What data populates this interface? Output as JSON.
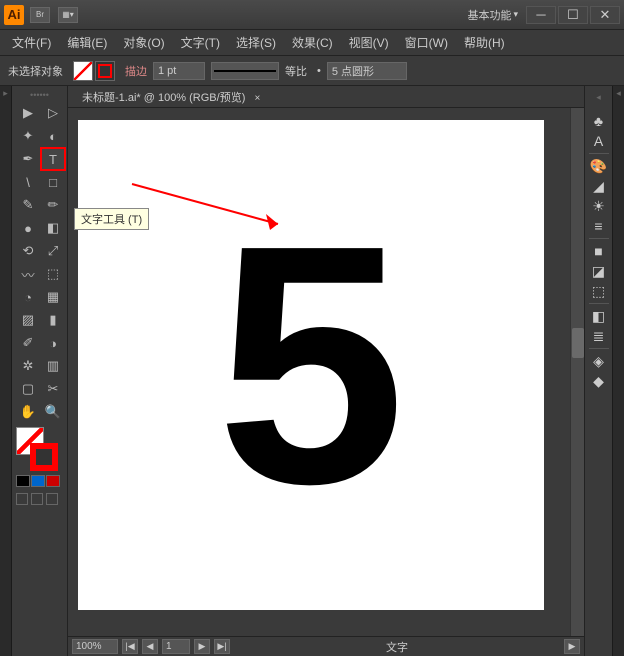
{
  "titlebar": {
    "workspace": "基本功能",
    "bridge_icon": "Br"
  },
  "menus": [
    "文件(F)",
    "编辑(E)",
    "对象(O)",
    "文字(T)",
    "选择(S)",
    "效果(C)",
    "视图(V)",
    "窗口(W)",
    "帮助(H)"
  ],
  "control": {
    "no_selection": "未选择对象",
    "stroke_label": "描边",
    "stroke_weight": "1 pt",
    "uniform": "等比",
    "profile": "5 点圆形"
  },
  "doc": {
    "tab_label": "未标题-1.ai* @ 100% (RGB/预览)",
    "close": "×"
  },
  "canvas": {
    "content": "5"
  },
  "tooltip": {
    "text": "文字工具 (T)"
  },
  "status": {
    "zoom": "100%",
    "page": "1",
    "label": "文字"
  },
  "tools": {
    "row": [
      [
        "selection",
        "▶"
      ],
      [
        "direct-selection",
        "▷"
      ],
      [
        "magic-wand",
        "✦"
      ],
      [
        "lasso",
        "◐"
      ],
      [
        "pen",
        "✒"
      ],
      [
        "type",
        "T"
      ],
      [
        "line",
        "\\"
      ],
      [
        "rectangle",
        "□"
      ],
      [
        "paintbrush",
        "✎"
      ],
      [
        "pencil",
        "✏"
      ],
      [
        "blob",
        "●"
      ],
      [
        "eraser",
        "◧"
      ],
      [
        "rotate",
        "⟲"
      ],
      [
        "scale",
        "⤢"
      ],
      [
        "width",
        "〰"
      ],
      [
        "free-transform",
        "⬚"
      ],
      [
        "shape-builder",
        "◔"
      ],
      [
        "perspective",
        "▦"
      ],
      [
        "mesh",
        "▨"
      ],
      [
        "gradient",
        "▮"
      ],
      [
        "eyedropper",
        "✐"
      ],
      [
        "blend",
        "◑"
      ],
      [
        "symbol-sprayer",
        "✲"
      ],
      [
        "column-graph",
        "▥"
      ],
      [
        "artboard",
        "▢"
      ],
      [
        "slice",
        "✂"
      ],
      [
        "hand",
        "✋"
      ],
      [
        "zoom",
        "🔍"
      ]
    ]
  },
  "panels": [
    "♣",
    "A",
    "🎨",
    "◢",
    "☀",
    "≡",
    "■",
    "◪",
    "⬚",
    "◧",
    "≣",
    "◈",
    "◆"
  ]
}
